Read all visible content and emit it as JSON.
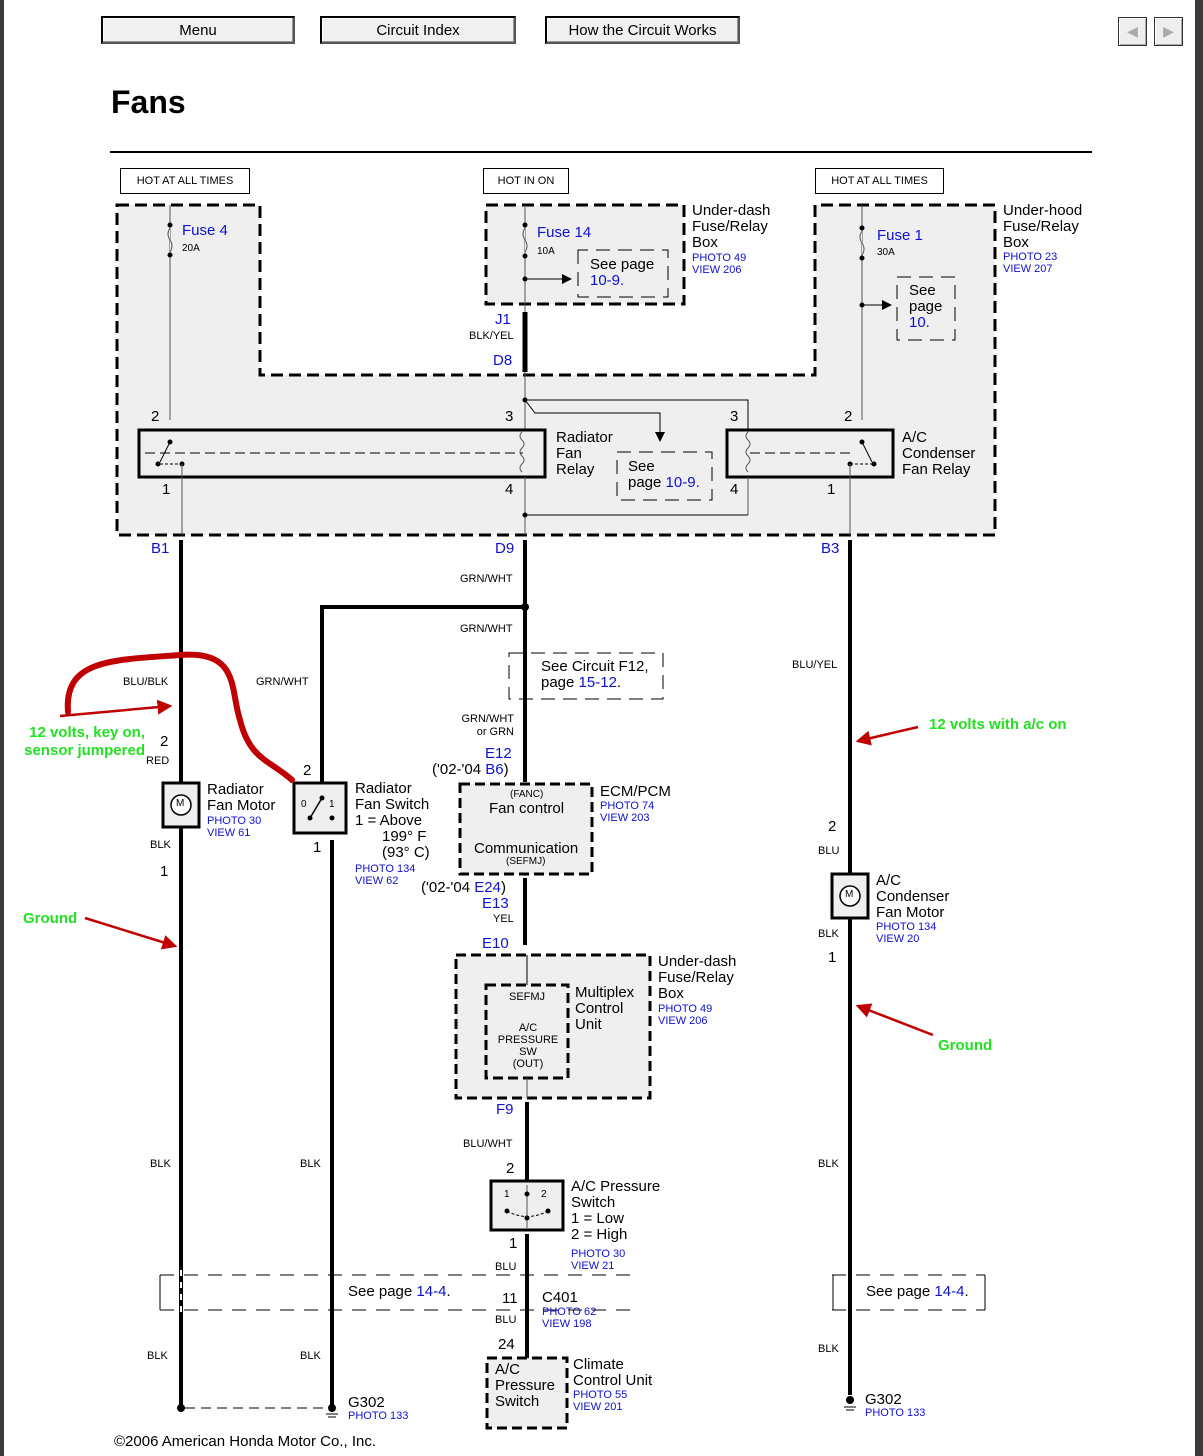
{
  "nav": {
    "menu": "Menu",
    "circuit_index": "Circuit Index",
    "how_circuit_works": "How the Circuit Works",
    "prev_icon": "◀",
    "next_icon": "▶"
  },
  "page_title": "Fans",
  "power_labels": {
    "left": "HOT AT ALL TIMES",
    "center": "HOT IN ON",
    "right": "HOT AT ALL TIMES"
  },
  "fuses": {
    "fuse4": {
      "name": "Fuse 4",
      "rating": "20A"
    },
    "fuse14": {
      "name": "Fuse 14",
      "rating": "10A"
    },
    "fuse1": {
      "name": "Fuse 1",
      "rating": "30A"
    }
  },
  "underdash_box": {
    "line1": "Under-dash",
    "line2": "Fuse/Relay",
    "line3": "Box",
    "photo": "PHOTO 49",
    "view": "VIEW 206"
  },
  "underhood_box": {
    "line1": "Under-hood",
    "line2": "Fuse/Relay",
    "line3": "Box",
    "photo": "PHOTO 23",
    "view": "VIEW 207"
  },
  "see_page_fuse14": {
    "text": "See page",
    "link": "10-9."
  },
  "see_page_fuse1": {
    "l1": "See",
    "l2": "page",
    "link": "10."
  },
  "connectors": {
    "j1": "J1",
    "d8": "D8",
    "b1": "B1",
    "d9": "D9",
    "b3": "B3",
    "e12": "E12",
    "b6_prefix": "('02-'04 ",
    "b6": "B6",
    "b6_suffix": ")",
    "e24_prefix": "('02-'04 ",
    "e24": "E24",
    "e24_suffix": ")",
    "e13": "E13",
    "e10": "E10",
    "f9": "F9"
  },
  "wires": {
    "blk_yel": "BLK/YEL",
    "grn_wht_1": "GRN/WHT",
    "grn_wht_2": "GRN/WHT",
    "grn_wht_switch": "GRN/WHT",
    "grn_wht_or_grn_1": "GRN/WHT",
    "grn_wht_or_grn_2": "or GRN",
    "blu_blk": "BLU/BLK",
    "red": "RED",
    "blk_motor": "BLK",
    "blu_yel": "BLU/YEL",
    "blu_ac": "BLU",
    "blk_ac": "BLK",
    "yel": "YEL",
    "blu_wht": "BLU/WHT",
    "blu_1": "BLU",
    "blu_2": "BLU",
    "blk_l1": "BLK",
    "blk_l2": "BLK",
    "blk_m1": "BLK",
    "blk_m2": "BLK",
    "blk_r1": "BLK",
    "blk_r2": "BLK"
  },
  "pins": {
    "rad_relay_2": "2",
    "rad_relay_1": "1",
    "rad_relay_3": "3",
    "rad_relay_4": "4",
    "ac_relay_3": "3",
    "ac_relay_4": "4",
    "ac_relay_2": "2",
    "ac_relay_1": "1",
    "rad_motor_2": "2",
    "rad_motor_1": "1",
    "rad_switch_2": "2",
    "rad_switch_1": "1",
    "ac_motor_2": "2",
    "ac_motor_1": "1",
    "pressure_2": "2",
    "pressure_1": "1",
    "c401_11": "11",
    "ccu_24": "24"
  },
  "relays": {
    "radiator": {
      "l1": "Radiator",
      "l2": "Fan",
      "l3": "Relay"
    },
    "ac_condenser": {
      "l1": "A/C",
      "l2": "Condenser",
      "l3": "Fan Relay"
    }
  },
  "see_page_relay": {
    "l1": "See",
    "l2": "page ",
    "link": "10-9."
  },
  "radiator_fan_motor": {
    "l1": "Radiator",
    "l2": "Fan Motor",
    "photo": "PHOTO 30",
    "view": "VIEW 61",
    "symbol": "M"
  },
  "radiator_fan_switch": {
    "l1": "Radiator",
    "l2": "Fan Switch",
    "l3": "1 = Above",
    "l4": "199° F",
    "l5": "(93° C)",
    "photo": "PHOTO 134",
    "view": "VIEW 62",
    "pos0": "0",
    "pos1": "1"
  },
  "see_circuit_f12": {
    "l1": "See Circuit F12,",
    "l2": "page ",
    "link": "15-12",
    "dot": "."
  },
  "ecm": {
    "fanc": "(FANC)",
    "fan_control": "Fan control",
    "communication": "Communication",
    "sefmj": "(SEFMJ)",
    "name": "ECM/PCM",
    "photo": "PHOTO 74",
    "view": "VIEW 203"
  },
  "mcu": {
    "sefmj": "SEFMJ",
    "l1": "A/C",
    "l2": "PRESSURE",
    "l3": "SW",
    "l4": "(OUT)",
    "name1": "Multiplex",
    "name2": "Control",
    "name3": "Unit",
    "box1": "Under-dash",
    "box2": "Fuse/Relay",
    "box3": "Box",
    "photo": "PHOTO 49",
    "view": "VIEW 206"
  },
  "ac_pressure_switch": {
    "l1": "A/C Pressure",
    "l2": "Switch",
    "l3": "1 = Low",
    "l4": "2 = High",
    "photo": "PHOTO 30",
    "view": "VIEW 21",
    "pos1": "1",
    "pos2": "2"
  },
  "c401": {
    "name": "C401",
    "photo": "PHOTO 62",
    "view": "VIEW 198"
  },
  "climate_control": {
    "in1": "A/C",
    "in2": "Pressure",
    "in3": "Switch",
    "l1": "Climate",
    "l2": "Control Unit",
    "photo": "PHOTO 55",
    "view": "VIEW 201"
  },
  "ac_condenser_motor": {
    "l1": "A/C",
    "l2": "Condenser",
    "l3": "Fan Motor",
    "photo": "PHOTO 134",
    "view": "VIEW 20",
    "symbol": "M"
  },
  "see_page_ground_left": {
    "text": "See page ",
    "link": "14-4",
    "dot": "."
  },
  "see_page_ground_right": {
    "text": "See page ",
    "link": "14-4",
    "dot": "."
  },
  "ground_left": {
    "name": "G302",
    "photo": "PHOTO 133"
  },
  "ground_right": {
    "name": "G302",
    "photo": "PHOTO 133"
  },
  "annotations": {
    "left_volts_1": "12 volts, key on,",
    "left_volts_2": "sensor jumpered",
    "left_ground": "Ground",
    "right_volts": "12 volts with a/c on",
    "right_ground": "Ground",
    "color_text": "#22e022",
    "color_arrow": "#c00000"
  },
  "copyright": "©2006 American Honda Motor Co., Inc."
}
